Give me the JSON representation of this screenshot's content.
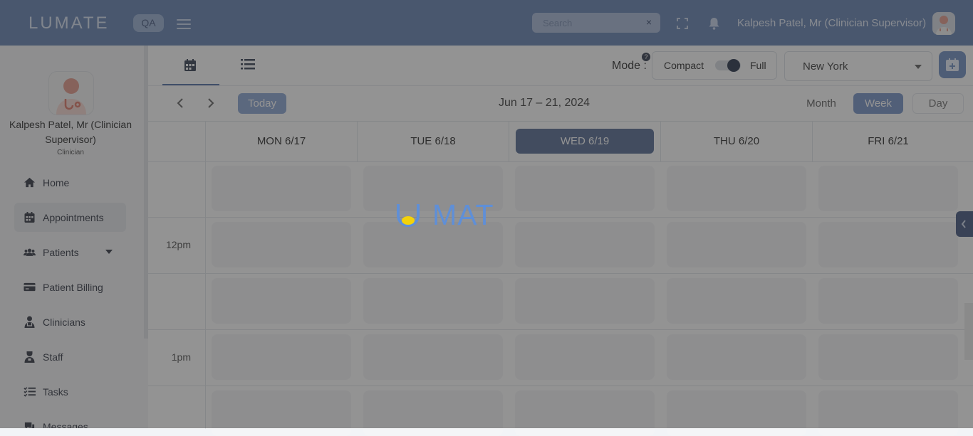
{
  "app": {
    "logo_text": "LUMATE",
    "env_badge": "QA"
  },
  "header": {
    "search_placeholder": "Search",
    "search_clear": "×",
    "user_name": "Kalpesh Patel, Mr (Clinician Supervisor)"
  },
  "sidebar": {
    "profile_name": "Kalpesh Patel, Mr (Clinician Supervisor)",
    "profile_role": "Clinician",
    "items": [
      {
        "label": "Home",
        "icon": "home-icon"
      },
      {
        "label": "Appointments",
        "icon": "calendar-icon",
        "active": true
      },
      {
        "label": "Patients",
        "icon": "users-icon",
        "has_submenu": true
      },
      {
        "label": "Patient Billing",
        "icon": "credit-card-icon"
      },
      {
        "label": "Clinicians",
        "icon": "clinician-icon"
      },
      {
        "label": "Staff",
        "icon": "staff-icon"
      },
      {
        "label": "Tasks",
        "icon": "tasks-icon"
      },
      {
        "label": "Messages",
        "icon": "messages-icon"
      }
    ]
  },
  "toolbar": {
    "mode_label": "Mode :",
    "help_glyph": "?",
    "mode_compact": "Compact",
    "mode_full": "Full",
    "mode_full_selected": true,
    "timezone": "New York"
  },
  "calendar": {
    "today_label": "Today",
    "date_range": "Jun 17 – 21, 2024",
    "views": {
      "month": "Month",
      "week": "Week",
      "day": "Day",
      "selected": "Week"
    },
    "days": [
      "MON 6/17",
      "TUE 6/18",
      "WED 6/19",
      "THU 6/20",
      "FRI 6/21"
    ],
    "today_index": 2,
    "time_labels": [
      "12pm",
      "1pm"
    ]
  },
  "loader": {
    "text": "MAT"
  },
  "colors": {
    "brand": "#6a86b5",
    "accent": "#7b97c9",
    "loader_blue": "#5f8fd7",
    "loader_yellow": "#f4d20a"
  }
}
